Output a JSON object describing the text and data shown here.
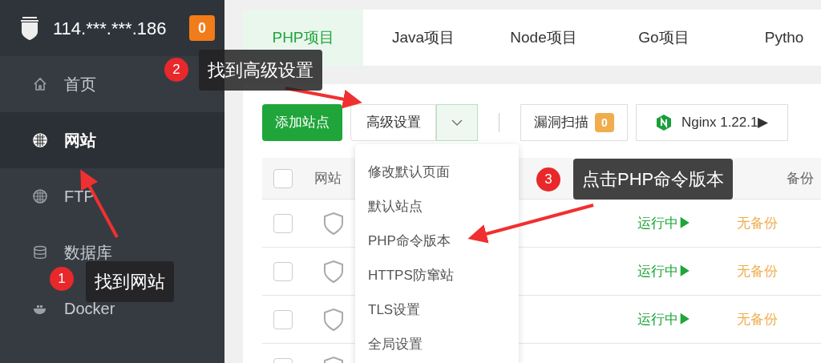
{
  "sidebar": {
    "host": "114.***.***.186",
    "badge": "0",
    "items": [
      {
        "label": "首页",
        "selected": false
      },
      {
        "label": "网站",
        "selected": true
      },
      {
        "label": "FTP",
        "selected": false
      },
      {
        "label": "数据库",
        "selected": false
      },
      {
        "label": "Docker",
        "selected": false
      }
    ]
  },
  "tabs": [
    {
      "label": "PHP项目",
      "selected": true
    },
    {
      "label": "Java项目",
      "selected": false
    },
    {
      "label": "Node项目",
      "selected": false
    },
    {
      "label": "Go项目",
      "selected": false
    },
    {
      "label": "Pytho",
      "selected": false
    }
  ],
  "toolbar": {
    "add_button": "添加站点",
    "advanced_button": "高级设置",
    "scan_button": {
      "label": "漏洞扫描",
      "badge": "0"
    },
    "nginx_button": "Nginx 1.22.1▶"
  },
  "table": {
    "header_checked": false,
    "columns": [
      "网站",
      "备份"
    ],
    "rows": [
      {
        "checked": false,
        "status": "运行中▶",
        "backup": "无备份"
      },
      {
        "checked": false,
        "status": "运行中▶",
        "backup": "无备份"
      },
      {
        "checked": false,
        "status": "运行中▶",
        "backup": "无备份"
      },
      {
        "checked": false
      }
    ]
  },
  "dropdown": {
    "items": [
      "修改默认页面",
      "默认站点",
      "PHP命令版本",
      "HTTPS防窜站",
      "TLS设置",
      "全局设置"
    ]
  },
  "annotations": [
    {
      "number": "1",
      "text": "找到网站"
    },
    {
      "number": "2",
      "text": "找到高级设置"
    },
    {
      "number": "3",
      "text": "点击PHP命令版本"
    }
  ]
}
